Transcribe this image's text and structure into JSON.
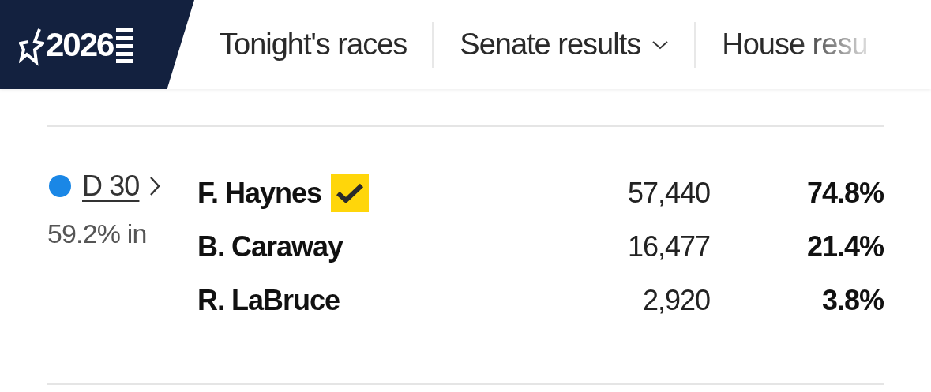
{
  "logo": {
    "text": "2026"
  },
  "nav": [
    {
      "label": "Tonight's races",
      "kind": "link",
      "cut_off": false
    },
    {
      "label": "Senate results",
      "kind": "dropdown",
      "cut_off": false
    },
    {
      "label": "House resu",
      "kind": "link",
      "cut_off": true
    }
  ],
  "race": {
    "district": "D 30",
    "color": "#1a87e6",
    "reporting": "59.2% in",
    "candidates": [
      {
        "name": "F. Haynes",
        "winner": true,
        "votes": "57,440",
        "percent": "74.8%"
      },
      {
        "name": "B. Caraway",
        "winner": false,
        "votes": "16,477",
        "percent": "21.4%"
      },
      {
        "name": "R. LaBruce",
        "winner": false,
        "votes": "2,920",
        "percent": "3.8%"
      }
    ]
  }
}
